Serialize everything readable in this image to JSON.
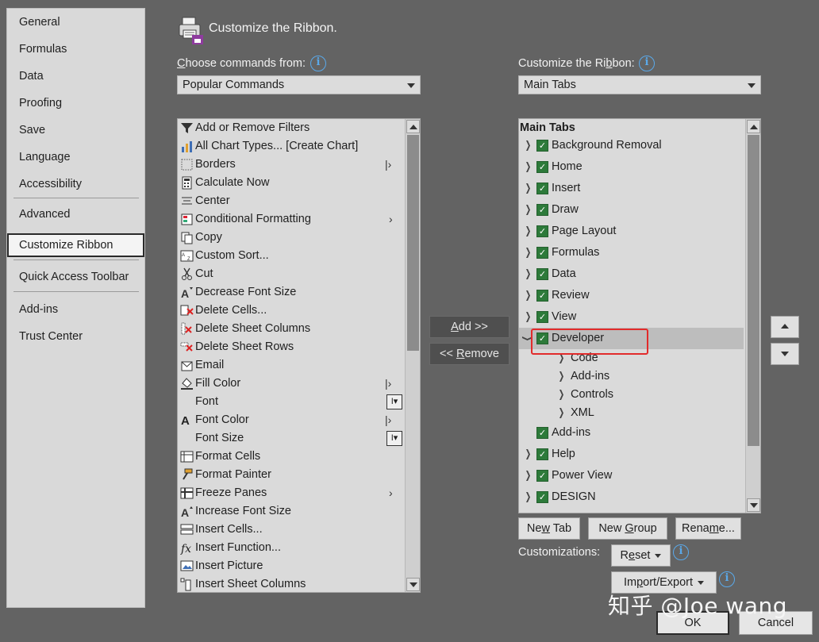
{
  "nav": {
    "items": [
      "General",
      "Formulas",
      "Data",
      "Proofing",
      "Save",
      "Language",
      "Accessibility",
      "Advanced",
      "Customize Ribbon",
      "Quick Access Toolbar",
      "Add-ins",
      "Trust Center"
    ],
    "selected": "Customize Ribbon"
  },
  "header": {
    "title": "Customize the Ribbon."
  },
  "left_panel": {
    "label": "Choose commands from:",
    "dropdown_value": "Popular Commands",
    "commands": [
      {
        "label": "Add or Remove Filters",
        "icon": "filter-icon"
      },
      {
        "label": "All Chart Types... [Create Chart]",
        "icon": "chart-icon"
      },
      {
        "label": "Borders",
        "icon": "borders-icon"
      },
      {
        "label": "Calculate Now",
        "icon": "calculator-icon"
      },
      {
        "label": "Center",
        "icon": "align-center-icon"
      },
      {
        "label": "Conditional Formatting",
        "icon": "conditional-formatting-icon"
      },
      {
        "label": "Copy",
        "icon": "copy-icon"
      },
      {
        "label": "Custom Sort...",
        "icon": "sort-icon"
      },
      {
        "label": "Cut",
        "icon": "scissors-icon"
      },
      {
        "label": "Decrease Font Size",
        "icon": "decrease-font-icon"
      },
      {
        "label": "Delete Cells...",
        "icon": "delete-cells-icon"
      },
      {
        "label": "Delete Sheet Columns",
        "icon": "delete-columns-icon"
      },
      {
        "label": "Delete Sheet Rows",
        "icon": "delete-rows-icon"
      },
      {
        "label": "Email",
        "icon": "email-icon"
      },
      {
        "label": "Fill Color",
        "icon": "fill-color-icon"
      },
      {
        "label": "Font",
        "icon": ""
      },
      {
        "label": "Font Color",
        "icon": "font-color-icon"
      },
      {
        "label": "Font Size",
        "icon": ""
      },
      {
        "label": "Format Cells",
        "icon": "format-cells-icon"
      },
      {
        "label": "Format Painter",
        "icon": "format-painter-icon"
      },
      {
        "label": "Freeze Panes",
        "icon": "freeze-panes-icon"
      },
      {
        "label": "Increase Font Size",
        "icon": "increase-font-icon"
      },
      {
        "label": "Insert Cells...",
        "icon": "insert-cells-icon"
      },
      {
        "label": "Insert Function...",
        "icon": "function-icon"
      },
      {
        "label": "Insert Picture",
        "icon": "picture-icon"
      },
      {
        "label": "Insert Sheet Columns",
        "icon": "insert-columns-icon"
      }
    ]
  },
  "middle": {
    "add_label": "Add >>",
    "remove_label": "<< Remove"
  },
  "right_panel": {
    "label": "Customize the Ribbon:",
    "dropdown_value": "Main Tabs",
    "tree_header": "Main Tabs",
    "tabs": [
      {
        "label": "Background Removal",
        "level": 0,
        "expand": "collapsed",
        "checked": true
      },
      {
        "label": "Home",
        "level": 0,
        "expand": "collapsed",
        "checked": true
      },
      {
        "label": "Insert",
        "level": 0,
        "expand": "collapsed",
        "checked": true
      },
      {
        "label": "Draw",
        "level": 0,
        "expand": "collapsed",
        "checked": true
      },
      {
        "label": "Page Layout",
        "level": 0,
        "expand": "collapsed",
        "checked": true
      },
      {
        "label": "Formulas",
        "level": 0,
        "expand": "collapsed",
        "checked": true
      },
      {
        "label": "Data",
        "level": 0,
        "expand": "collapsed",
        "checked": true
      },
      {
        "label": "Review",
        "level": 0,
        "expand": "collapsed",
        "checked": true
      },
      {
        "label": "View",
        "level": 0,
        "expand": "collapsed",
        "checked": true
      },
      {
        "label": "Developer",
        "level": 0,
        "expand": "expanded",
        "checked": true,
        "highlight": true
      },
      {
        "label": "Code",
        "level": 1,
        "expand": "collapsed",
        "checked": null
      },
      {
        "label": "Add-ins",
        "level": 1,
        "expand": "collapsed",
        "checked": null
      },
      {
        "label": "Controls",
        "level": 1,
        "expand": "collapsed",
        "checked": null
      },
      {
        "label": "XML",
        "level": 1,
        "expand": "collapsed",
        "checked": null
      },
      {
        "label": "Add-ins",
        "level": 0,
        "expand": "none",
        "checked": true
      },
      {
        "label": "Help",
        "level": 0,
        "expand": "collapsed",
        "checked": true
      },
      {
        "label": "Power View",
        "level": 0,
        "expand": "collapsed",
        "checked": true
      },
      {
        "label": "DESIGN",
        "level": 0,
        "expand": "collapsed",
        "checked": true
      }
    ],
    "new_tab_label": "New Tab",
    "new_group_label": "New Group",
    "rename_label": "Rename...",
    "customizations_label": "Customizations:",
    "reset_label": "Reset",
    "import_export_label": "Import/Export"
  },
  "footer": {
    "ok_label": "OK",
    "cancel_label": "Cancel"
  },
  "watermark": "知乎 @Joe wang",
  "colors": {
    "check": "#2d7a3a",
    "info": "#5aa9ea",
    "highlight_box": "#e22b2b",
    "dialog_bg": "#636363"
  }
}
